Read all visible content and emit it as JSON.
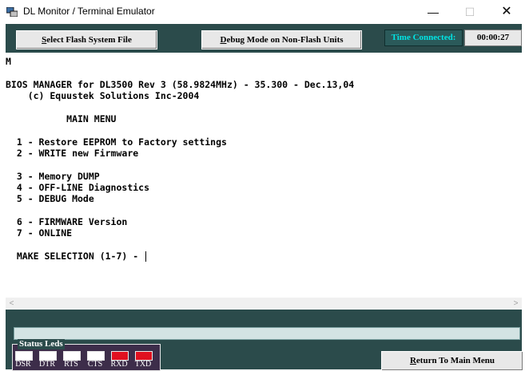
{
  "window": {
    "title": "DL Monitor / Terminal Emulator",
    "icon": "app-icon",
    "controls": {
      "minimize": "—",
      "maximize": "☐",
      "close": "✕"
    }
  },
  "toolbar": {
    "select_flash": {
      "first": "S",
      "rest": "elect Flash System File"
    },
    "debug_mode": {
      "first": "D",
      "rest": "ebug Mode on Non-Flash Units"
    },
    "time_connected_label": "Time Connected:",
    "time_connected_value": "00:00:27"
  },
  "terminal": {
    "lines": [
      "M",
      "",
      "BIOS MANAGER for DL3500 Rev 3 (58.9824MHz) - 35.300 - Dec.13,04",
      "    (c) Equustek Solutions Inc-2004",
      "",
      "           MAIN MENU",
      "",
      "  1 - Restore EEPROM to Factory settings",
      "  2 - WRITE new Firmware",
      "",
      "  3 - Memory DUMP",
      "  4 - OFF-LINE Diagnostics",
      "  5 - DEBUG Mode",
      "",
      "  6 - FIRMWARE Version",
      "  7 - ONLINE",
      "",
      "  MAKE SELECTION (1-7) - "
    ]
  },
  "scrollbar": {
    "left_arrow": "<",
    "right_arrow": ">"
  },
  "status_leds": {
    "title": "Status Leds",
    "leds": [
      {
        "label": "DSR",
        "color": "#ffffff"
      },
      {
        "label": "DTR",
        "color": "#ffffff"
      },
      {
        "label": "RTS",
        "color": "#ffffff"
      },
      {
        "label": "CTS",
        "color": "#ffffff"
      },
      {
        "label": "RXD",
        "color": "#e01020"
      },
      {
        "label": "TXD",
        "color": "#e01020"
      }
    ]
  },
  "return_button": {
    "first": "R",
    "rest": "eturn To Main Menu"
  },
  "colors": {
    "panel": "#2b4b4b",
    "time_label_text": "#00e5e5",
    "led_active": "#e01020"
  }
}
